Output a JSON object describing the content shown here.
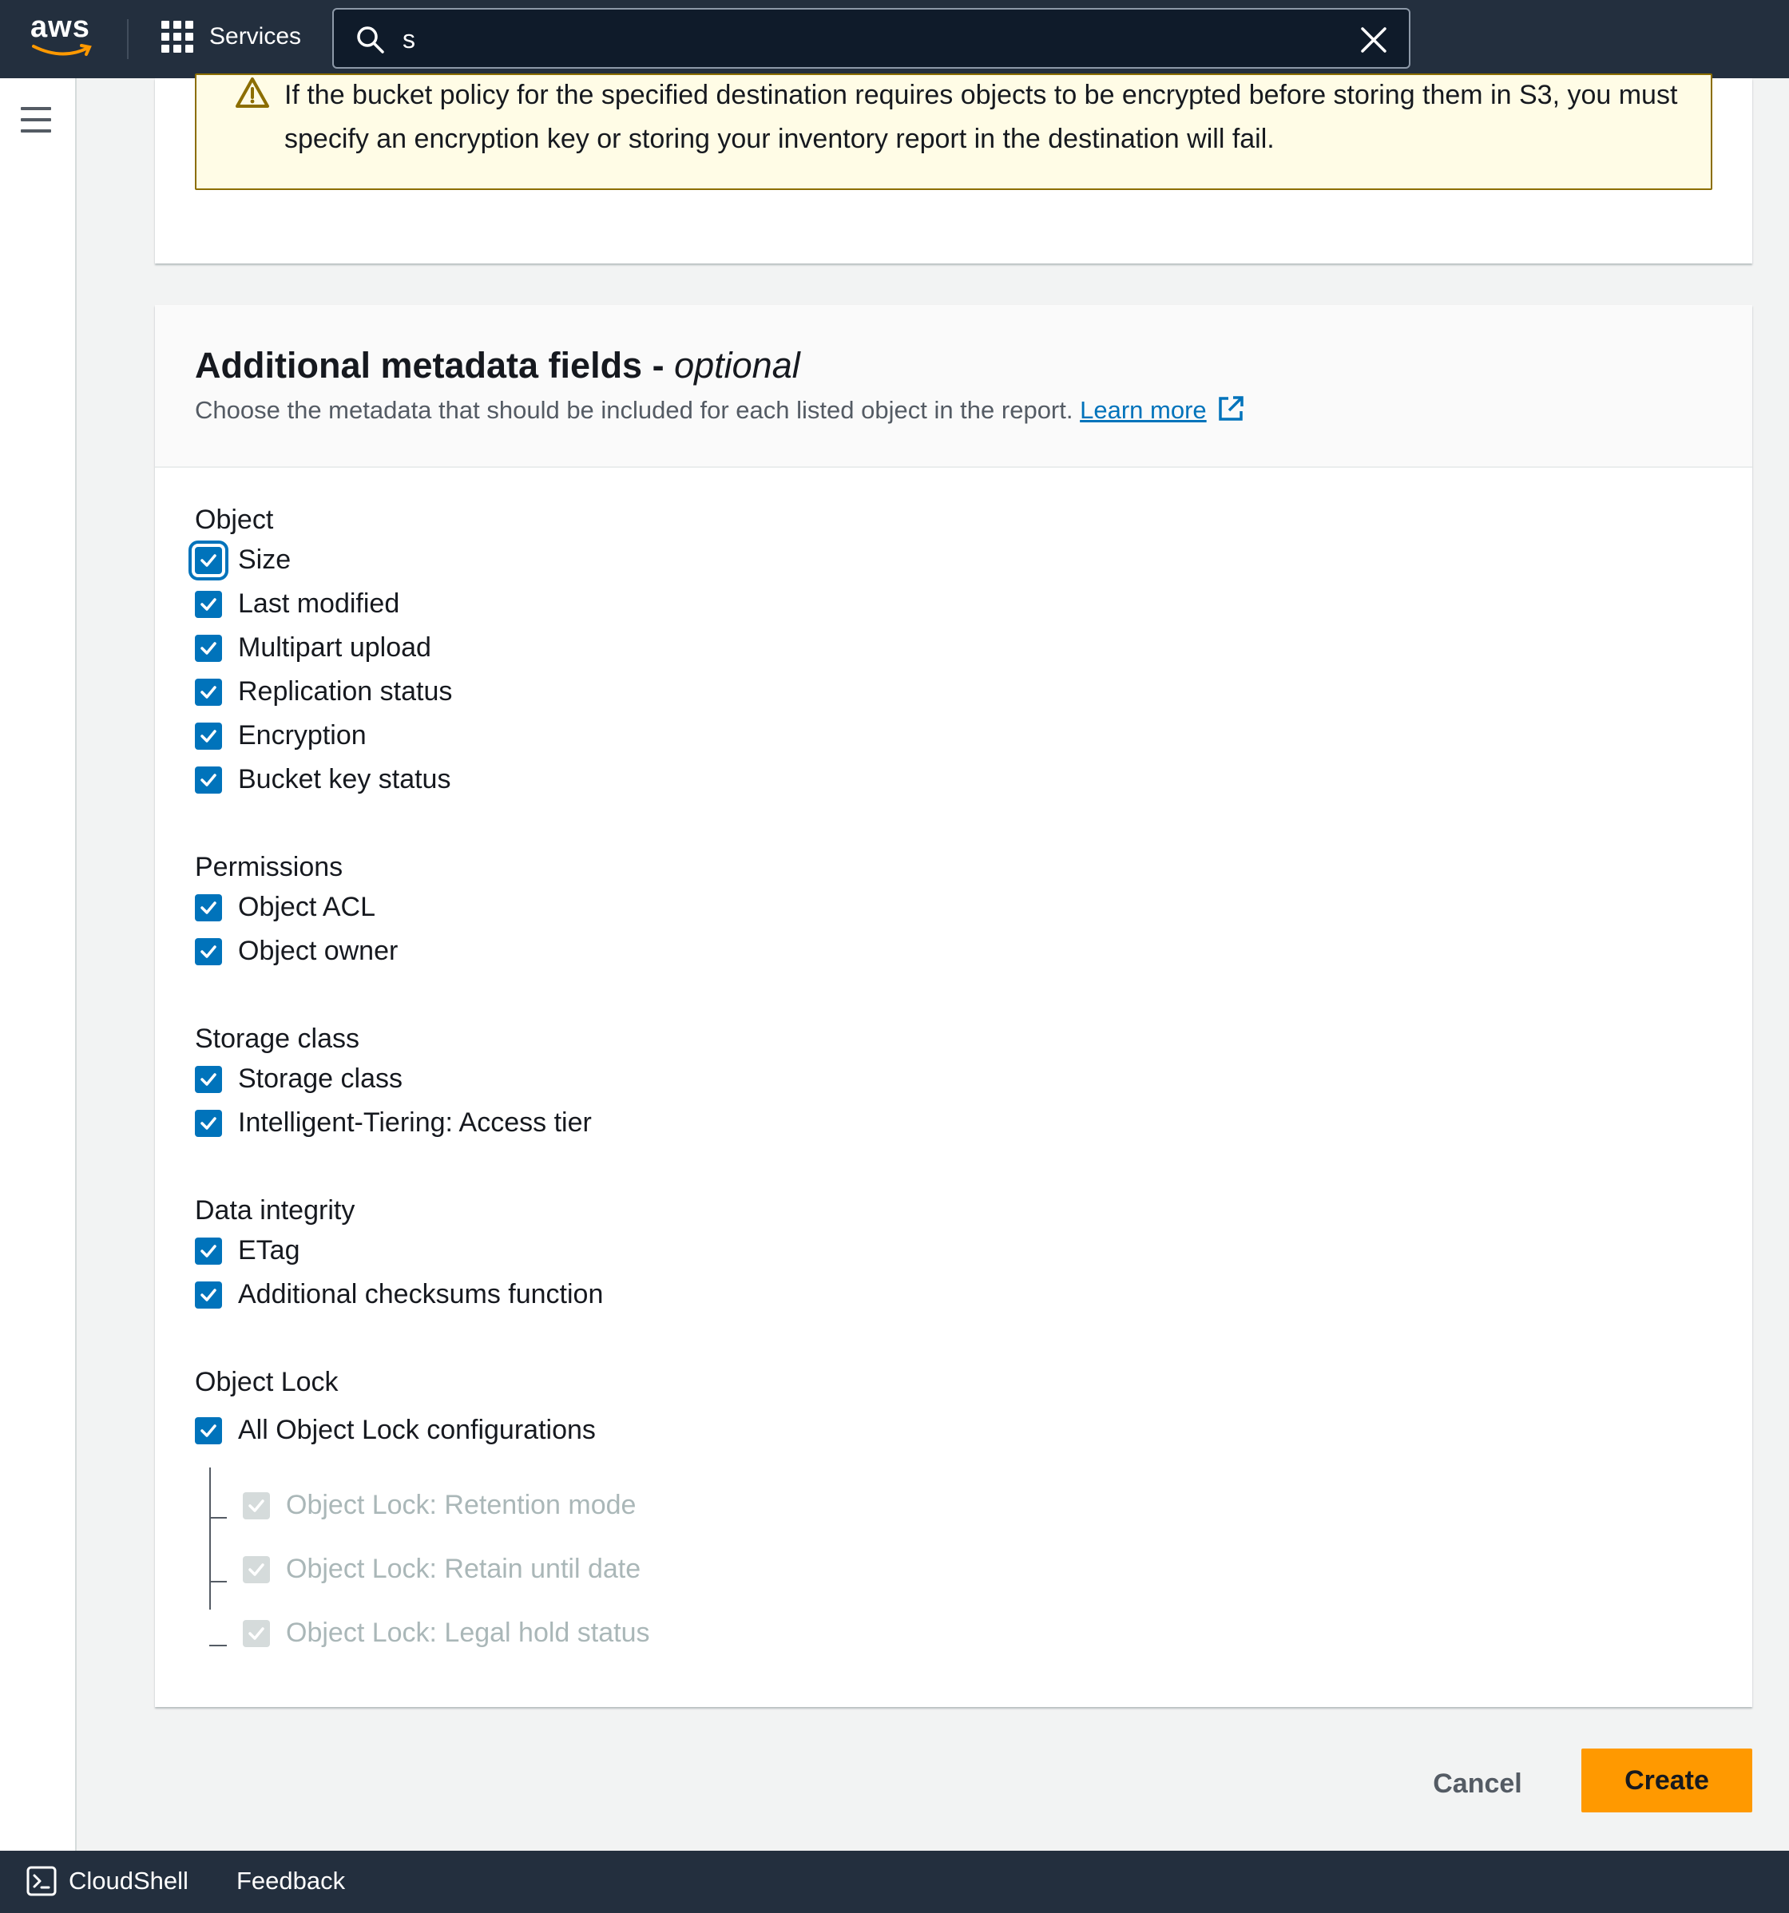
{
  "topnav": {
    "logo_text": "aws",
    "services_label": "Services",
    "search": {
      "value": "s"
    }
  },
  "alert": {
    "text": "If the bucket policy for the specified destination requires objects to be encrypted before storing them in S3, you must specify an encryption key or storing your inventory report in the destination will fail."
  },
  "panel": {
    "title": "Additional metadata fields",
    "title_sep": " - ",
    "title_optional": "optional",
    "description": "Choose the metadata that should be included for each listed object in the report.",
    "learn_more": "Learn more"
  },
  "groups": {
    "object": {
      "label": "Object",
      "items": [
        "Size",
        "Last modified",
        "Multipart upload",
        "Replication status",
        "Encryption",
        "Bucket key status"
      ]
    },
    "permissions": {
      "label": "Permissions",
      "items": [
        "Object ACL",
        "Object owner"
      ]
    },
    "storage": {
      "label": "Storage class",
      "items": [
        "Storage class",
        "Intelligent-Tiering: Access tier"
      ]
    },
    "integrity": {
      "label": "Data integrity",
      "items": [
        "ETag",
        "Additional checksums function"
      ]
    },
    "lock": {
      "label": "Object Lock",
      "all_label": "All Object Lock configurations",
      "items": [
        "Object Lock: Retention mode",
        "Object Lock: Retain until date",
        "Object Lock: Legal hold status"
      ]
    }
  },
  "actions": {
    "cancel": "Cancel",
    "create": "Create"
  },
  "bottombar": {
    "cloudshell": "CloudShell",
    "feedback": "Feedback"
  },
  "colors": {
    "nav_bg": "#232f3e",
    "checkbox": "#0073bb",
    "primary_button": "#ff9900",
    "warning_border": "#8c6e00",
    "warning_bg": "#fffce6"
  },
  "icons": [
    "aws-logo-icon",
    "services-grid-icon",
    "search-icon",
    "clear-icon",
    "hamburger-menu-icon",
    "warning-icon",
    "external-link-icon",
    "checkmark-icon",
    "cloudshell-icon"
  ]
}
